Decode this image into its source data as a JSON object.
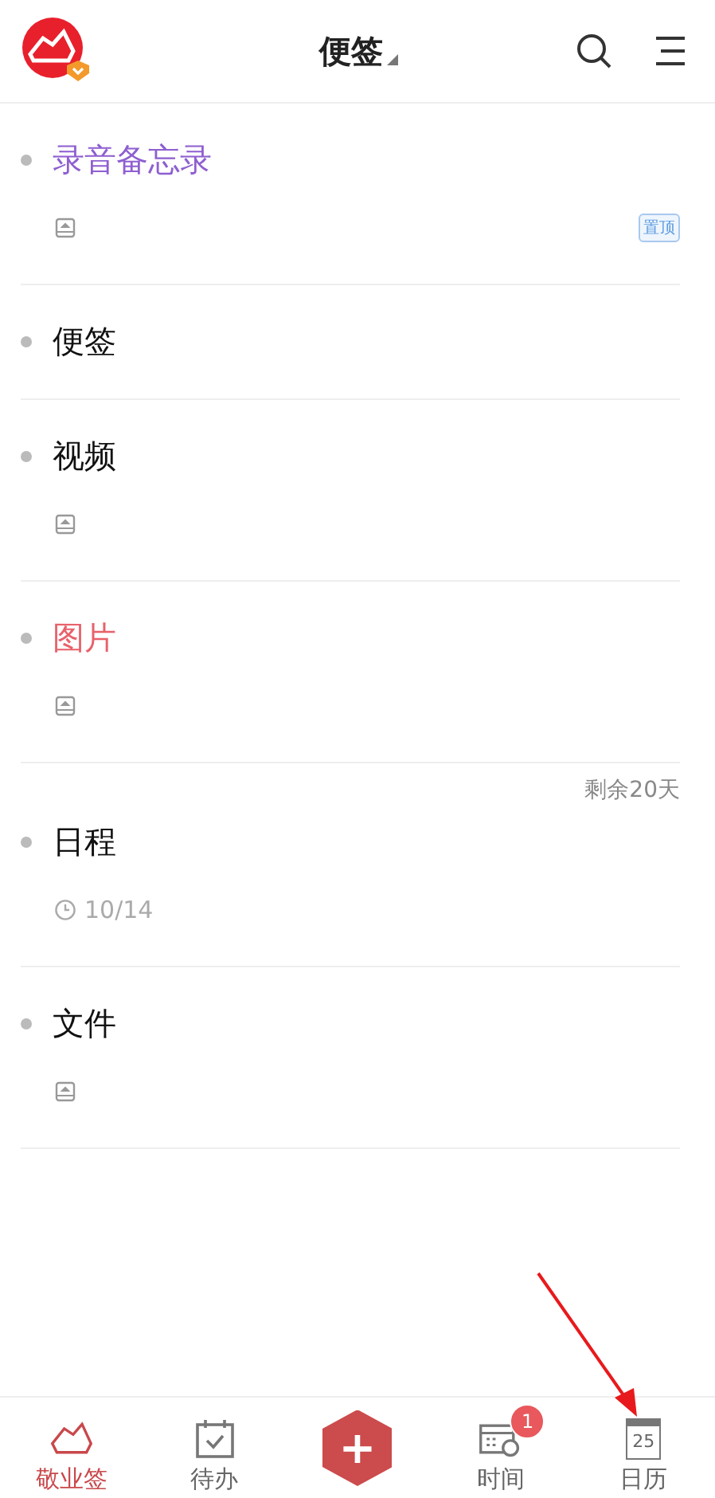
{
  "header": {
    "title": "便签"
  },
  "notes": [
    {
      "title": "录音备忘录",
      "color": "#8e5fd0",
      "kind": "attachment",
      "pinned_label": "置顶"
    },
    {
      "title": "便签",
      "color": "#111111",
      "kind": "plain"
    },
    {
      "title": "视频",
      "color": "#111111",
      "kind": "attachment"
    },
    {
      "title": "图片",
      "color": "#e8616a",
      "kind": "attachment"
    },
    {
      "title": "日程",
      "color": "#111111",
      "kind": "date",
      "date": "10/14",
      "remaining": "剩余20天"
    },
    {
      "title": "文件",
      "color": "#111111",
      "kind": "attachment"
    }
  ],
  "nav": [
    {
      "kind": "logo",
      "label": "敬业签",
      "selected": true
    },
    {
      "kind": "todo",
      "label": "待办",
      "selected": false
    },
    {
      "kind": "add",
      "symbol": "+"
    },
    {
      "kind": "time",
      "label": "时间",
      "selected": false,
      "badge": "1"
    },
    {
      "kind": "calendar",
      "label": "日历",
      "selected": false,
      "day": "25"
    }
  ]
}
